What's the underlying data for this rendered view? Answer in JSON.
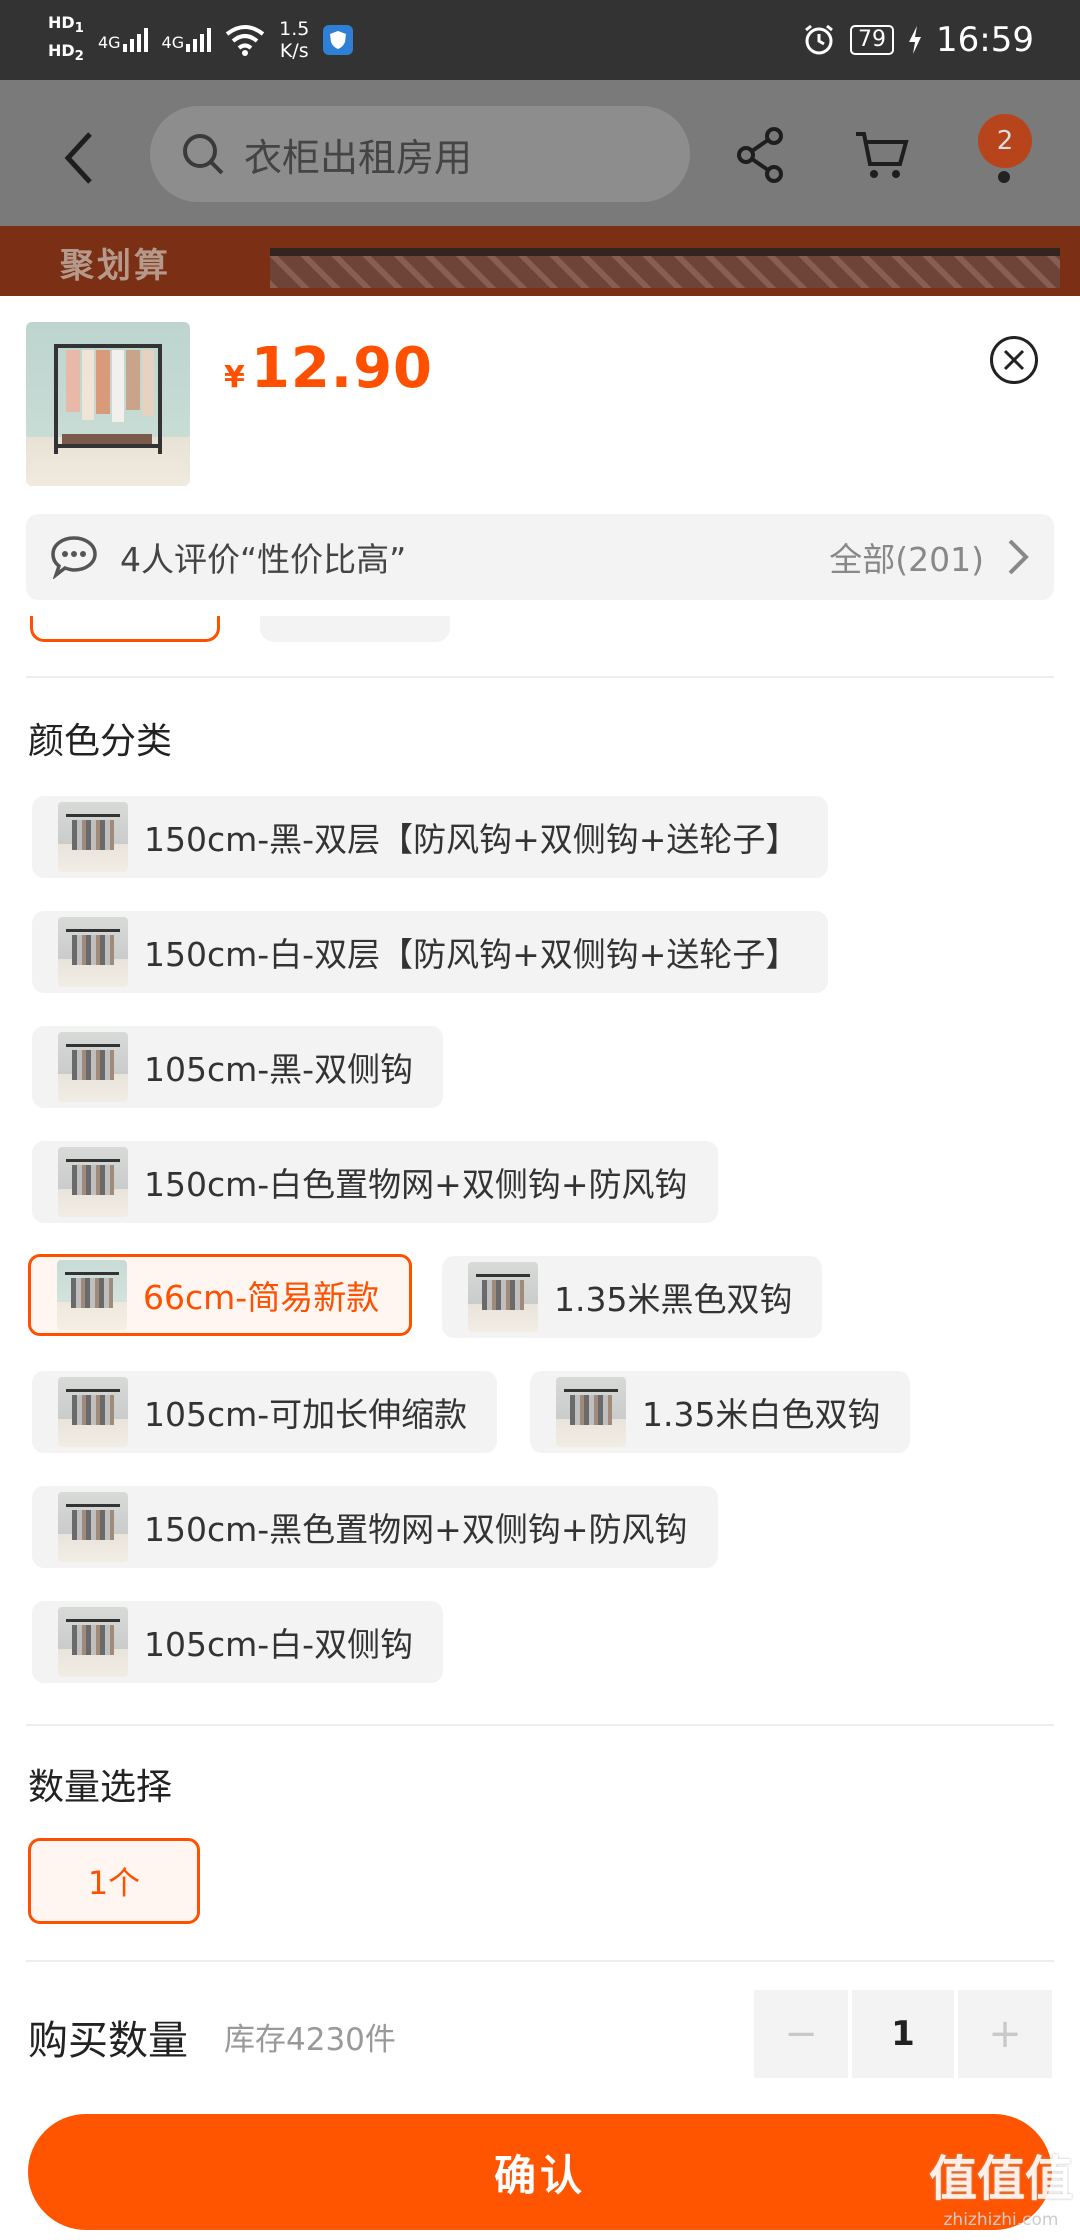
{
  "status_bar": {
    "hd1": "HD",
    "hd1_sub": "1",
    "hd2": "HD",
    "hd2_sub": "2",
    "net1": "4G",
    "net2": "4G",
    "speed_value": "1.5",
    "speed_unit": "K/s",
    "battery": "79",
    "time": "16:59"
  },
  "nav": {
    "search_placeholder": "衣柜出租房用",
    "badge_count": "2"
  },
  "banner": {
    "text": "聚划算"
  },
  "sheet": {
    "price_currency": "¥",
    "price": "12.90",
    "review_summary": "4人评价“性价比高”",
    "review_all": "全部(201)",
    "color_section_title": "颜色分类",
    "color_options": [
      {
        "label": "150cm-黑-双层【防风钩+双侧钩+送轮子】",
        "selected": false
      },
      {
        "label": "150cm-白-双层【防风钩+双侧钩+送轮子】",
        "selected": false
      },
      {
        "label": "105cm-黑-双侧钩",
        "selected": false
      },
      {
        "label": "150cm-白色置物网+双侧钩+防风钩",
        "selected": false
      },
      {
        "label": "66cm-简易新款",
        "selected": true
      },
      {
        "label": "1.35米黑色双钩",
        "selected": false
      },
      {
        "label": "105cm-可加长伸缩款",
        "selected": false
      },
      {
        "label": "1.35米白色双钩",
        "selected": false
      },
      {
        "label": "150cm-黑色置物网+双侧钩+防风钩",
        "selected": false
      },
      {
        "label": "105cm-白-双侧钩",
        "selected": false
      }
    ],
    "qty_section_title": "数量选择",
    "qty_option": "1个",
    "buy_label": "购买数量",
    "stock": "库存4230件",
    "minus": "−",
    "quantity": "1",
    "plus": "+",
    "confirm": "确认"
  },
  "watermark": {
    "big": "值值值",
    "small": "zhizhizhi.com"
  },
  "colors": {
    "accent": "#ff5000",
    "confirm": "#ff5500",
    "chip_bg": "#f3f3f3"
  }
}
